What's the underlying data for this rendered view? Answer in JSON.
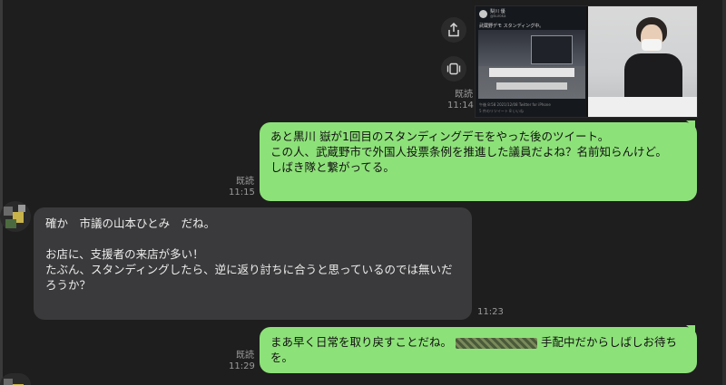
{
  "shared_image": {
    "tweet_user": "梨川 優",
    "tweet_handle": "@kuroka",
    "tweet_text": "武蔵野デモ スタンディング中。",
    "tweet_meta": "午後 8:58 2021/12/08 Twitter for iPhone",
    "tweet_meta2": "5 件のリツイート 8 いいね"
  },
  "side_actions": {
    "share_icon": "share-icon",
    "gallery_icon": "gallery-icon"
  },
  "messages": [
    {
      "type": "image",
      "read": "既読",
      "time": "11:14"
    },
    {
      "type": "sent",
      "read": "既読",
      "time": "11:15",
      "text": "あと黒川 嶽が1回目のスタンディングデモをやった後のツイート。\nこの人、武蔵野市で外国人投票条例を推進した議員だよね？名前知らんけど。\nしばき隊と繋がってる。"
    },
    {
      "type": "received",
      "time": "11:23",
      "text": "確か　市議の山本ひとみ　だね。\n\nお店に、支援者の来店が多い！\nたぶん、スタンディングしたら、逆に返り討ちに合うと思っているのでは無いだろうか？"
    },
    {
      "type": "sent",
      "read": "既読",
      "time": "11:29",
      "text_before": "まあ早く日常を取り戻すことだね。",
      "text_after": "手配中だからしばしお待ちを。"
    }
  ],
  "colors": {
    "background": "#1e1e1e",
    "sent_bubble": "#8de179",
    "received_bubble": "#3a3a3c"
  }
}
